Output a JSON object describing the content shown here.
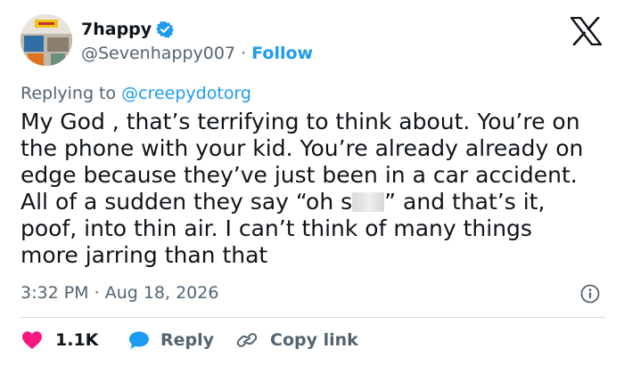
{
  "author": {
    "display_name": "7happy",
    "handle": "@Sevenhappy007",
    "separator": "·",
    "follow_label": "Follow",
    "verified_color": "#1d9bf0"
  },
  "reply_context": {
    "prefix": "Replying to ",
    "mention": "@creepydotorg"
  },
  "tweet": {
    "lines": [
      "My God , that’s terrifying to think about. You’re on",
      "the phone with your kid. You’re already already on",
      "edge because they’ve just been in a car accident.",
      "All of a sudden they say “oh s",
      "” and that’s it,",
      "poof, into thin air. I can’t think of many things",
      "more jarring than that"
    ]
  },
  "meta": {
    "time": "3:32 PM",
    "separator": "·",
    "date": "Aug 18, 2026"
  },
  "actions": {
    "like_count": "1.1K",
    "reply_label": "Reply",
    "copy_label": "Copy link"
  },
  "icons": {
    "verified": "verified-badge-icon",
    "brand": "x-logo-icon",
    "info": "info-icon",
    "like": "heart-icon",
    "reply": "speech-bubble-icon",
    "copy": "link-icon"
  },
  "colors": {
    "text": "#0f1419",
    "secondary": "#536471",
    "accent": "#1d9bf0",
    "like": "#f91880",
    "divider": "#cfd9de"
  }
}
